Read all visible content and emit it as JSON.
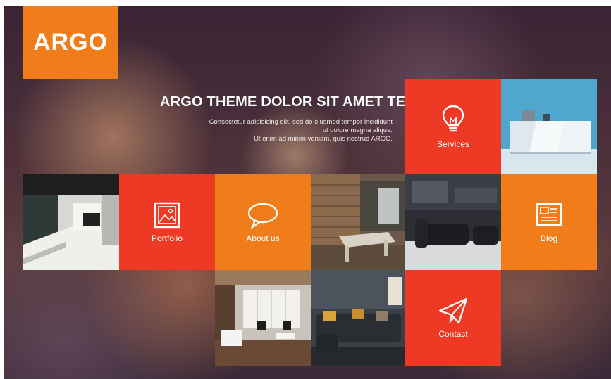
{
  "brand": {
    "logo_text": "ARGO"
  },
  "hero": {
    "title": "ARGO THEME DOLOR SIT AMET TELASDE",
    "subtitle_lines": [
      "Consectetur adipisicing elit, sed do eiusmod tempor incididunt",
      "ut dolore magna aliqua.",
      "Ut enim ad minim veniam, quis nostrud ARGO."
    ]
  },
  "tiles": {
    "services": {
      "label": "Services",
      "icon": "lightbulb-icon"
    },
    "portfolio": {
      "label": "Portfolio",
      "icon": "image-frame-icon"
    },
    "about": {
      "label": "About us",
      "icon": "speech-bubble-icon"
    },
    "blog": {
      "label": "Blog",
      "icon": "newspaper-icon"
    },
    "contact": {
      "label": "Contact",
      "icon": "paper-plane-icon"
    }
  },
  "colors": {
    "orange": "#f07d1a",
    "red": "#ee3a24"
  }
}
